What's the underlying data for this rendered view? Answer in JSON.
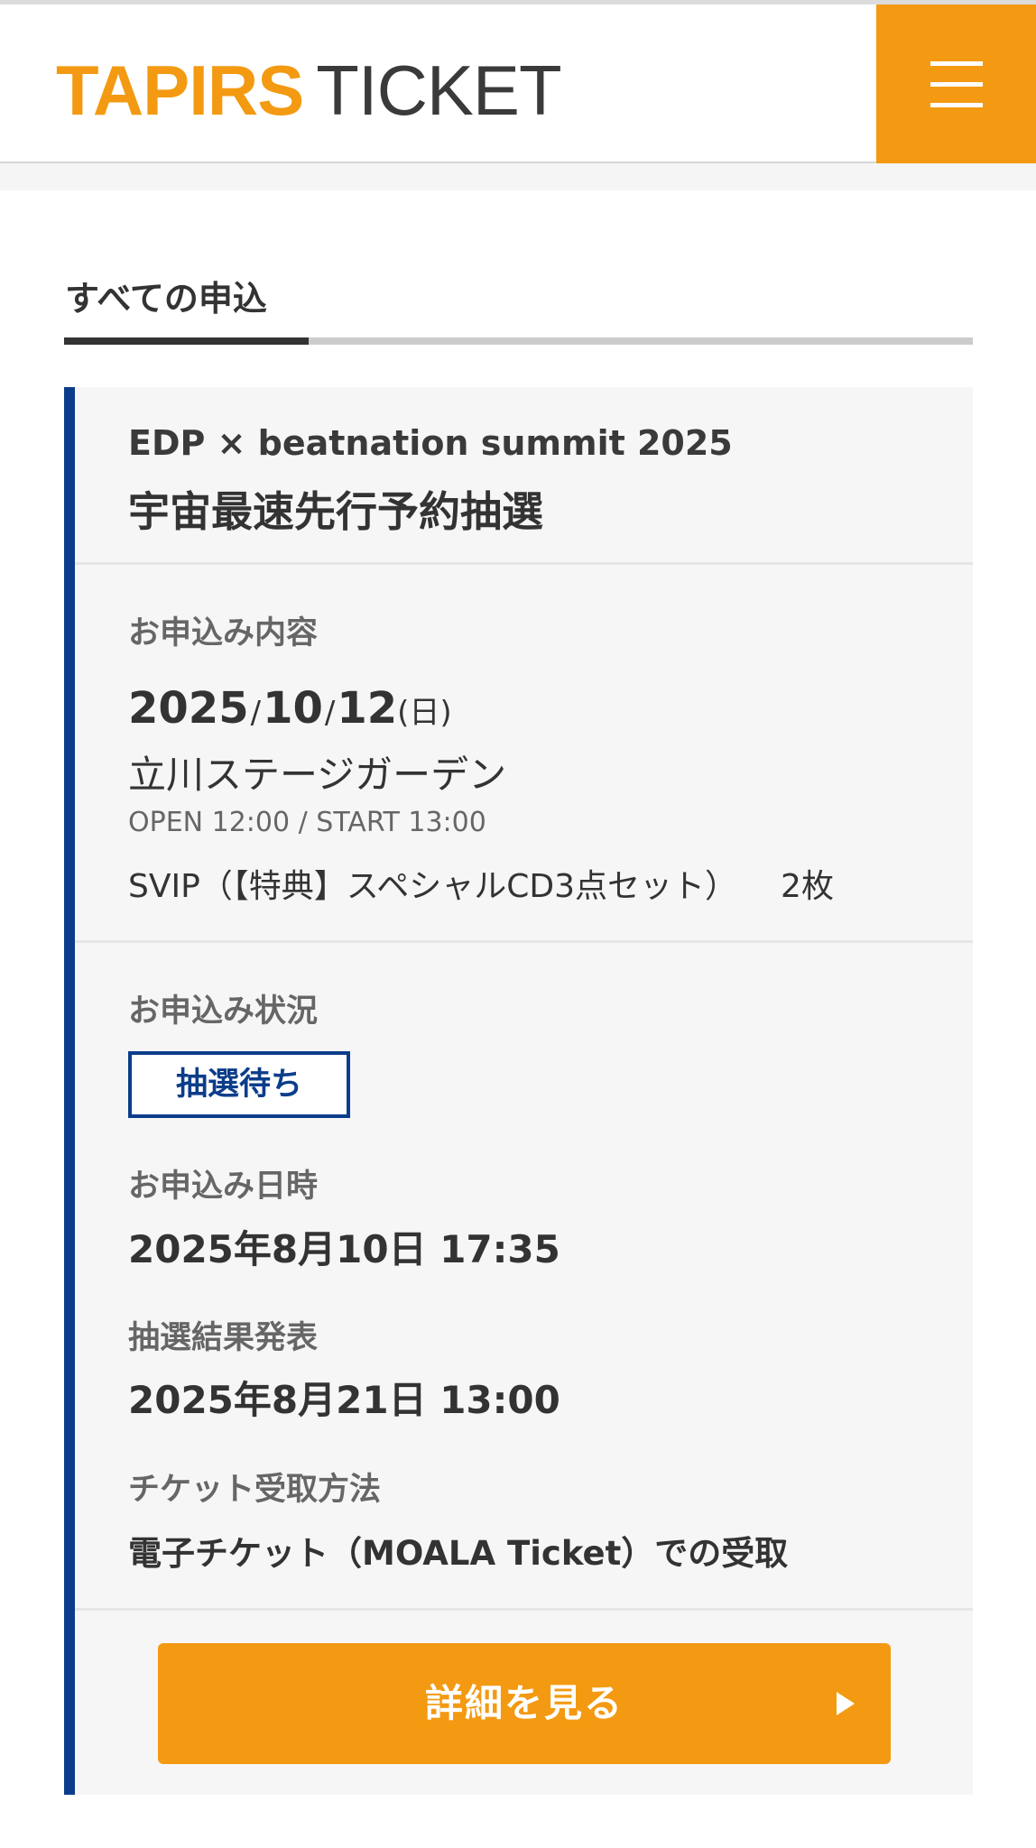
{
  "header": {
    "logo_brand": "TAPIRS",
    "logo_sub": "TICKET",
    "menu_icon": "hamburger-menu-icon"
  },
  "tabs": [
    {
      "label": "すべての申込",
      "active": true
    }
  ],
  "application": {
    "event_subtitle": "EDP × beatnation summit 2025",
    "event_title": "宇宙最速先行予約抽選",
    "content_label": "お申込み内容",
    "date": {
      "year": "2025",
      "month": "10",
      "day": "12",
      "separator": "/",
      "weekday": "(日)"
    },
    "venue": "立川ステージガーデン",
    "times": "OPEN 12:00 / START 13:00",
    "ticket_type": "SVIP（【特典】スペシャルCD3点セット）",
    "ticket_count": "2枚",
    "status_label": "お申込み状況",
    "status_badge": "抽選待ち",
    "applied_at_label": "お申込み日時",
    "applied_at": "2025年8月10日 17:35",
    "result_label": "抽選結果発表",
    "result_at": "2025年8月21日 13:00",
    "receive_label": "チケット受取方法",
    "receive_method": "電子チケット（MOALA Ticket）での受取",
    "detail_button": "詳細を見る"
  },
  "colors": {
    "brand_orange": "#f39a12",
    "accent_navy": "#0c3d8a",
    "card_bg": "#f6f6f6",
    "text_dark": "#333333",
    "text_gray": "#666666"
  }
}
